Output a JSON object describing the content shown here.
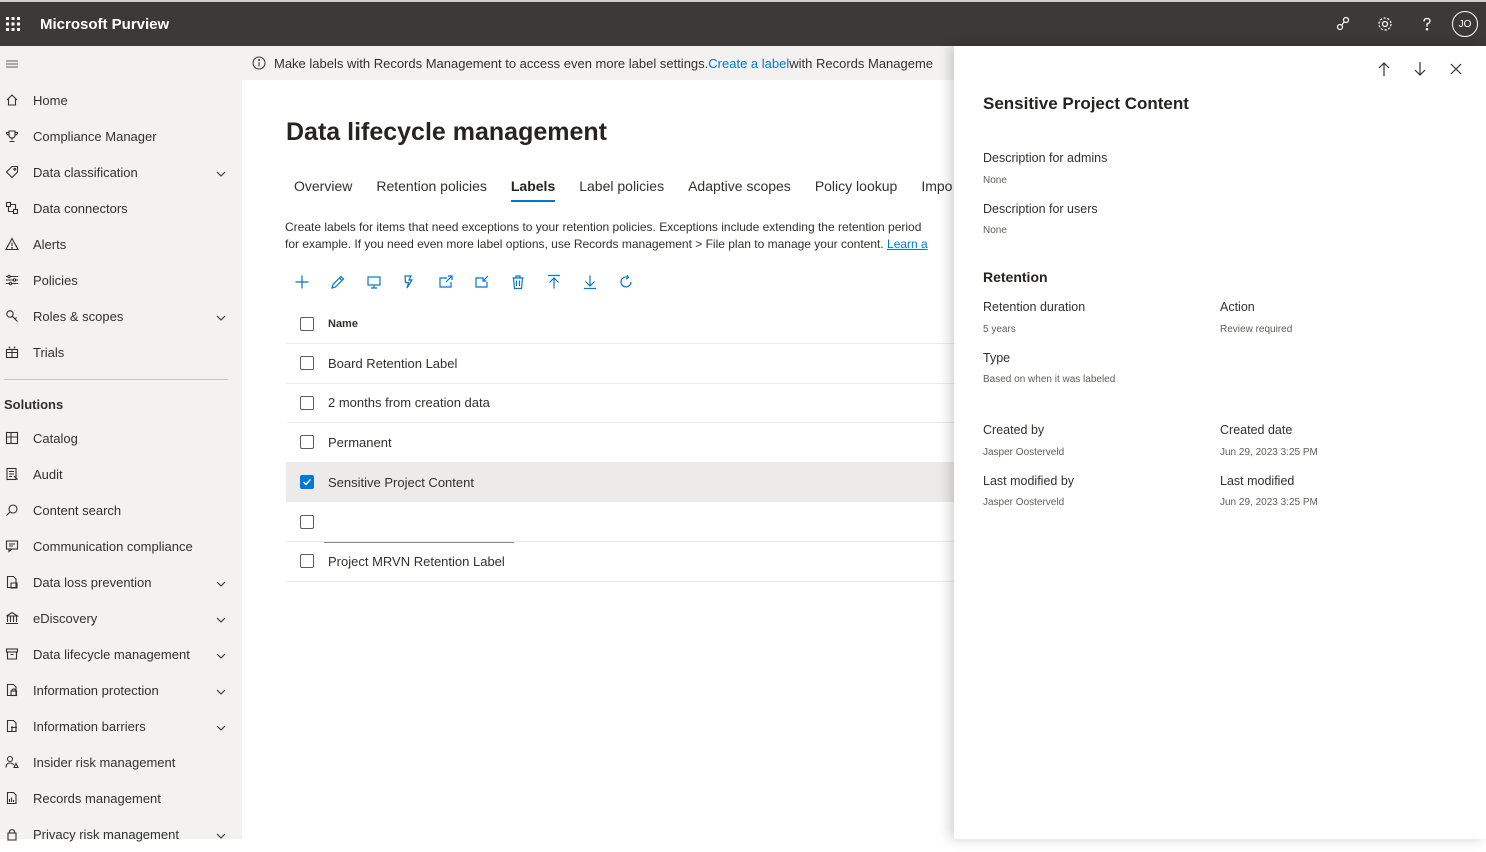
{
  "app": {
    "title": "Microsoft Purview",
    "user_initials": "JO"
  },
  "topbar_icons": [
    "share-icon",
    "gear-icon",
    "help-icon"
  ],
  "sidebar": {
    "items": [
      {
        "label": "Home",
        "icon": "home-icon",
        "expandable": false
      },
      {
        "label": "Compliance Manager",
        "icon": "trophy-icon",
        "expandable": false
      },
      {
        "label": "Data classification",
        "icon": "tag-icon",
        "expandable": true
      },
      {
        "label": "Data connectors",
        "icon": "connector-icon",
        "expandable": false
      },
      {
        "label": "Alerts",
        "icon": "alert-icon",
        "expandable": false
      },
      {
        "label": "Policies",
        "icon": "sliders-icon",
        "expandable": false
      },
      {
        "label": "Roles & scopes",
        "icon": "key-icon",
        "expandable": true
      },
      {
        "label": "Trials",
        "icon": "trial-icon",
        "expandable": false
      }
    ],
    "section_label": "Solutions",
    "solutions": [
      {
        "label": "Catalog",
        "icon": "catalog-icon",
        "expandable": false
      },
      {
        "label": "Audit",
        "icon": "audit-icon",
        "expandable": false
      },
      {
        "label": "Content search",
        "icon": "search-icon",
        "expandable": false
      },
      {
        "label": "Communication compliance",
        "icon": "chat-icon",
        "expandable": false
      },
      {
        "label": "Data loss prevention",
        "icon": "dlp-icon",
        "expandable": true
      },
      {
        "label": "eDiscovery",
        "icon": "ediscovery-icon",
        "expandable": true
      },
      {
        "label": "Data lifecycle management",
        "icon": "archive-icon",
        "expandable": true
      },
      {
        "label": "Information protection",
        "icon": "protection-icon",
        "expandable": true
      },
      {
        "label": "Information barriers",
        "icon": "barrier-icon",
        "expandable": true
      },
      {
        "label": "Insider risk management",
        "icon": "insider-icon",
        "expandable": false
      },
      {
        "label": "Records management",
        "icon": "records-icon",
        "expandable": false
      },
      {
        "label": "Privacy risk management",
        "icon": "privacy-icon",
        "expandable": true
      }
    ]
  },
  "banner": {
    "text_before": "Make labels with Records Management to access even more label settings. ",
    "link": "Create a label",
    "text_after": " with Records Manageme"
  },
  "main": {
    "title": "Data lifecycle management",
    "tabs": [
      {
        "label": "Overview",
        "active": false
      },
      {
        "label": "Retention policies",
        "active": false
      },
      {
        "label": "Labels",
        "active": true
      },
      {
        "label": "Label policies",
        "active": false
      },
      {
        "label": "Adaptive scopes",
        "active": false
      },
      {
        "label": "Policy lookup",
        "active": false
      },
      {
        "label": "Impo",
        "active": false
      }
    ],
    "description_line1": "Create labels for items that need exceptions to your retention policies. Exceptions include extending the retention period",
    "description_line2": "for example. If you need even more label options, use Records management > File plan to manage your content. ",
    "description_link": "Learn a",
    "toolbar": [
      "add-icon",
      "edit-icon",
      "view-icon",
      "publish-icon",
      "export-icon",
      "import-icon",
      "delete-icon",
      "upload-icon",
      "download-icon",
      "refresh-icon"
    ],
    "table": {
      "header": "Name",
      "rows": [
        {
          "name": "Board Retention Label",
          "checked": false
        },
        {
          "name": "2 months from creation data",
          "checked": false
        },
        {
          "name": "Permanent",
          "checked": false
        },
        {
          "name": "Sensitive Project Content",
          "checked": true
        },
        {
          "name": "",
          "checked": false
        },
        {
          "name": "Project MRVN Retention Label",
          "checked": false
        }
      ]
    }
  },
  "panel": {
    "title": "Sensitive Project Content",
    "desc_admins_label": "Description for admins",
    "desc_admins_value": "None",
    "desc_users_label": "Description for users",
    "desc_users_value": "None",
    "retention_title": "Retention",
    "retention_duration_label": "Retention duration",
    "retention_duration_value": "5 years",
    "action_label": "Action",
    "action_value": "Review required",
    "type_label": "Type",
    "type_value": "Based on when it was labeled",
    "created_by_label": "Created by",
    "created_by_value": "Jasper Oosterveld",
    "created_date_label": "Created date",
    "created_date_value": "Jun 29, 2023 3:25 PM",
    "modified_by_label": "Last modified by",
    "modified_by_value": "Jasper Oosterveld",
    "modified_label": "Last modified",
    "modified_value": "Jun 29, 2023 3:25 PM"
  },
  "colors": {
    "accent": "#0078d4",
    "topbar": "#3b3a39",
    "sidebar": "#f3f2f1"
  }
}
